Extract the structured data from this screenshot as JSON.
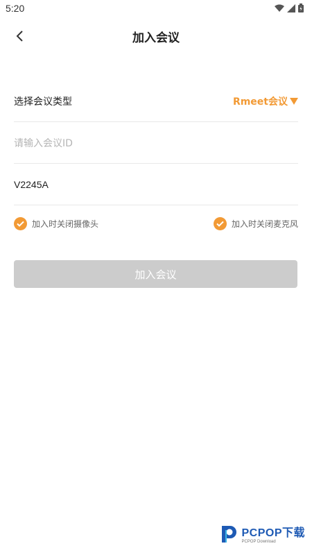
{
  "status_bar": {
    "time": "5:20",
    "icons": [
      "wifi-icon",
      "signal-icon",
      "battery-icon"
    ]
  },
  "header": {
    "title": "加入会议",
    "back_icon": "chevron-left-icon"
  },
  "form": {
    "meeting_type_label": "选择会议类型",
    "meeting_type_value": "Rmeet会议",
    "meeting_type_icon": "triangle-down-icon",
    "meeting_id_placeholder": "请输入会议ID",
    "name_value": "V2245A"
  },
  "options": {
    "camera_off_label": "加入时关闭摄像头",
    "camera_off_checked": true,
    "mic_off_label": "加入时关闭麦克风",
    "mic_off_checked": true
  },
  "join_button_label": "加入会议",
  "watermark": {
    "text": "PCPOP下载",
    "sub": "PCPOP Download"
  },
  "colors": {
    "accent": "#f29a35",
    "disabled_button": "#cccccc",
    "divider": "#e8e8e8",
    "placeholder": "#b5b5b5",
    "watermark_blue": "#1e5ab4"
  }
}
